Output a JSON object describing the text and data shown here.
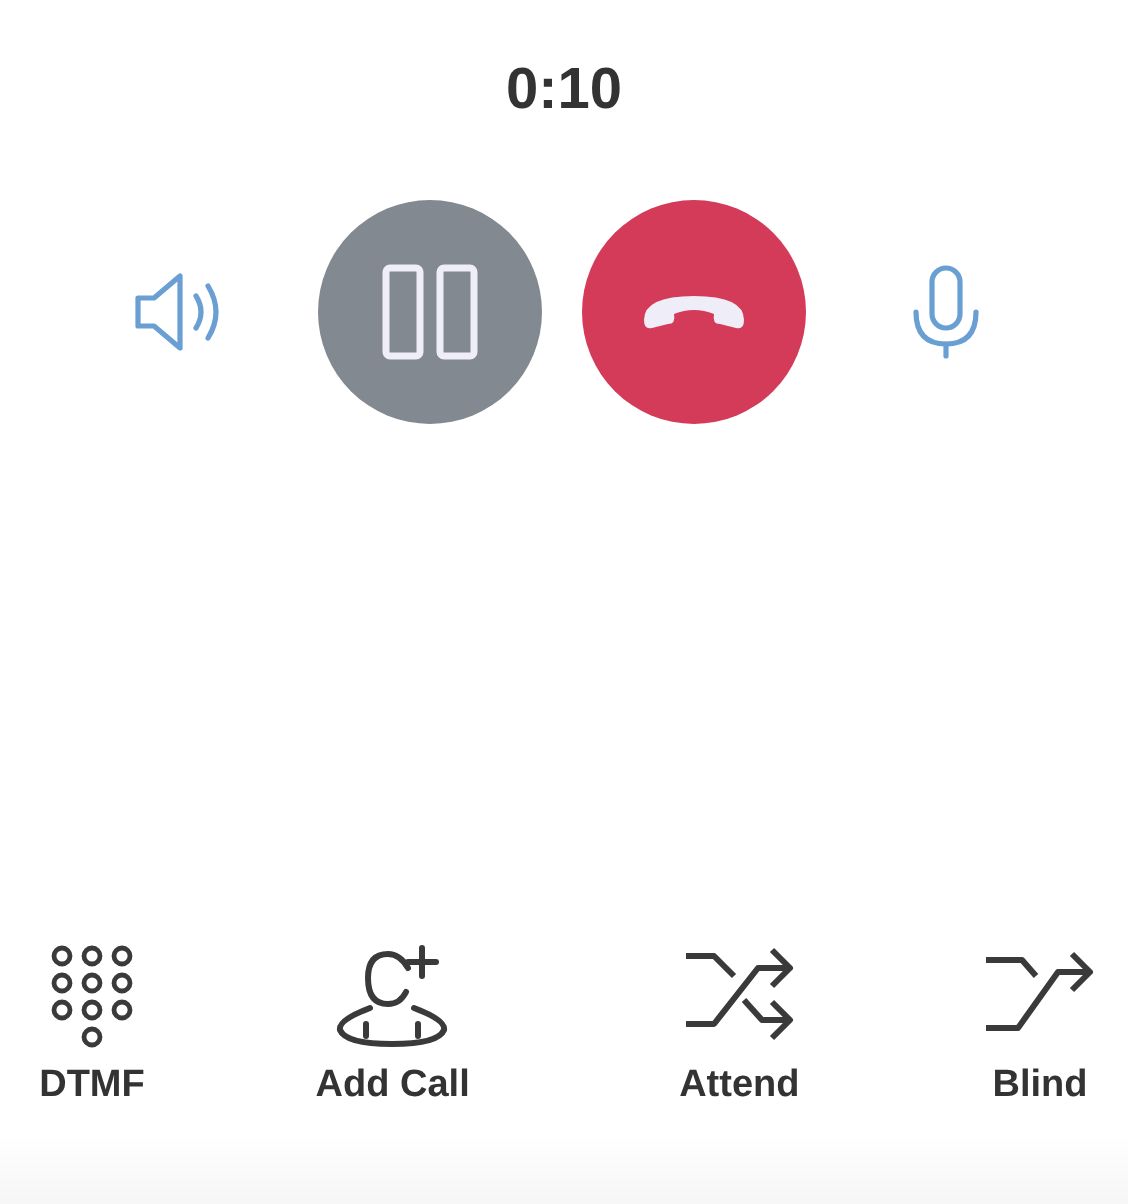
{
  "timer": "0:10",
  "controls": [
    {
      "kind": "speaker"
    },
    {
      "kind": "pause"
    },
    {
      "kind": "hangup"
    },
    {
      "kind": "mic"
    }
  ],
  "actions": [
    {
      "kind": "keypad",
      "label": "DTMF"
    },
    {
      "kind": "add",
      "label": "Add Call"
    },
    {
      "kind": "attend",
      "label": "Attend"
    },
    {
      "kind": "blind",
      "label": "Blind"
    }
  ]
}
